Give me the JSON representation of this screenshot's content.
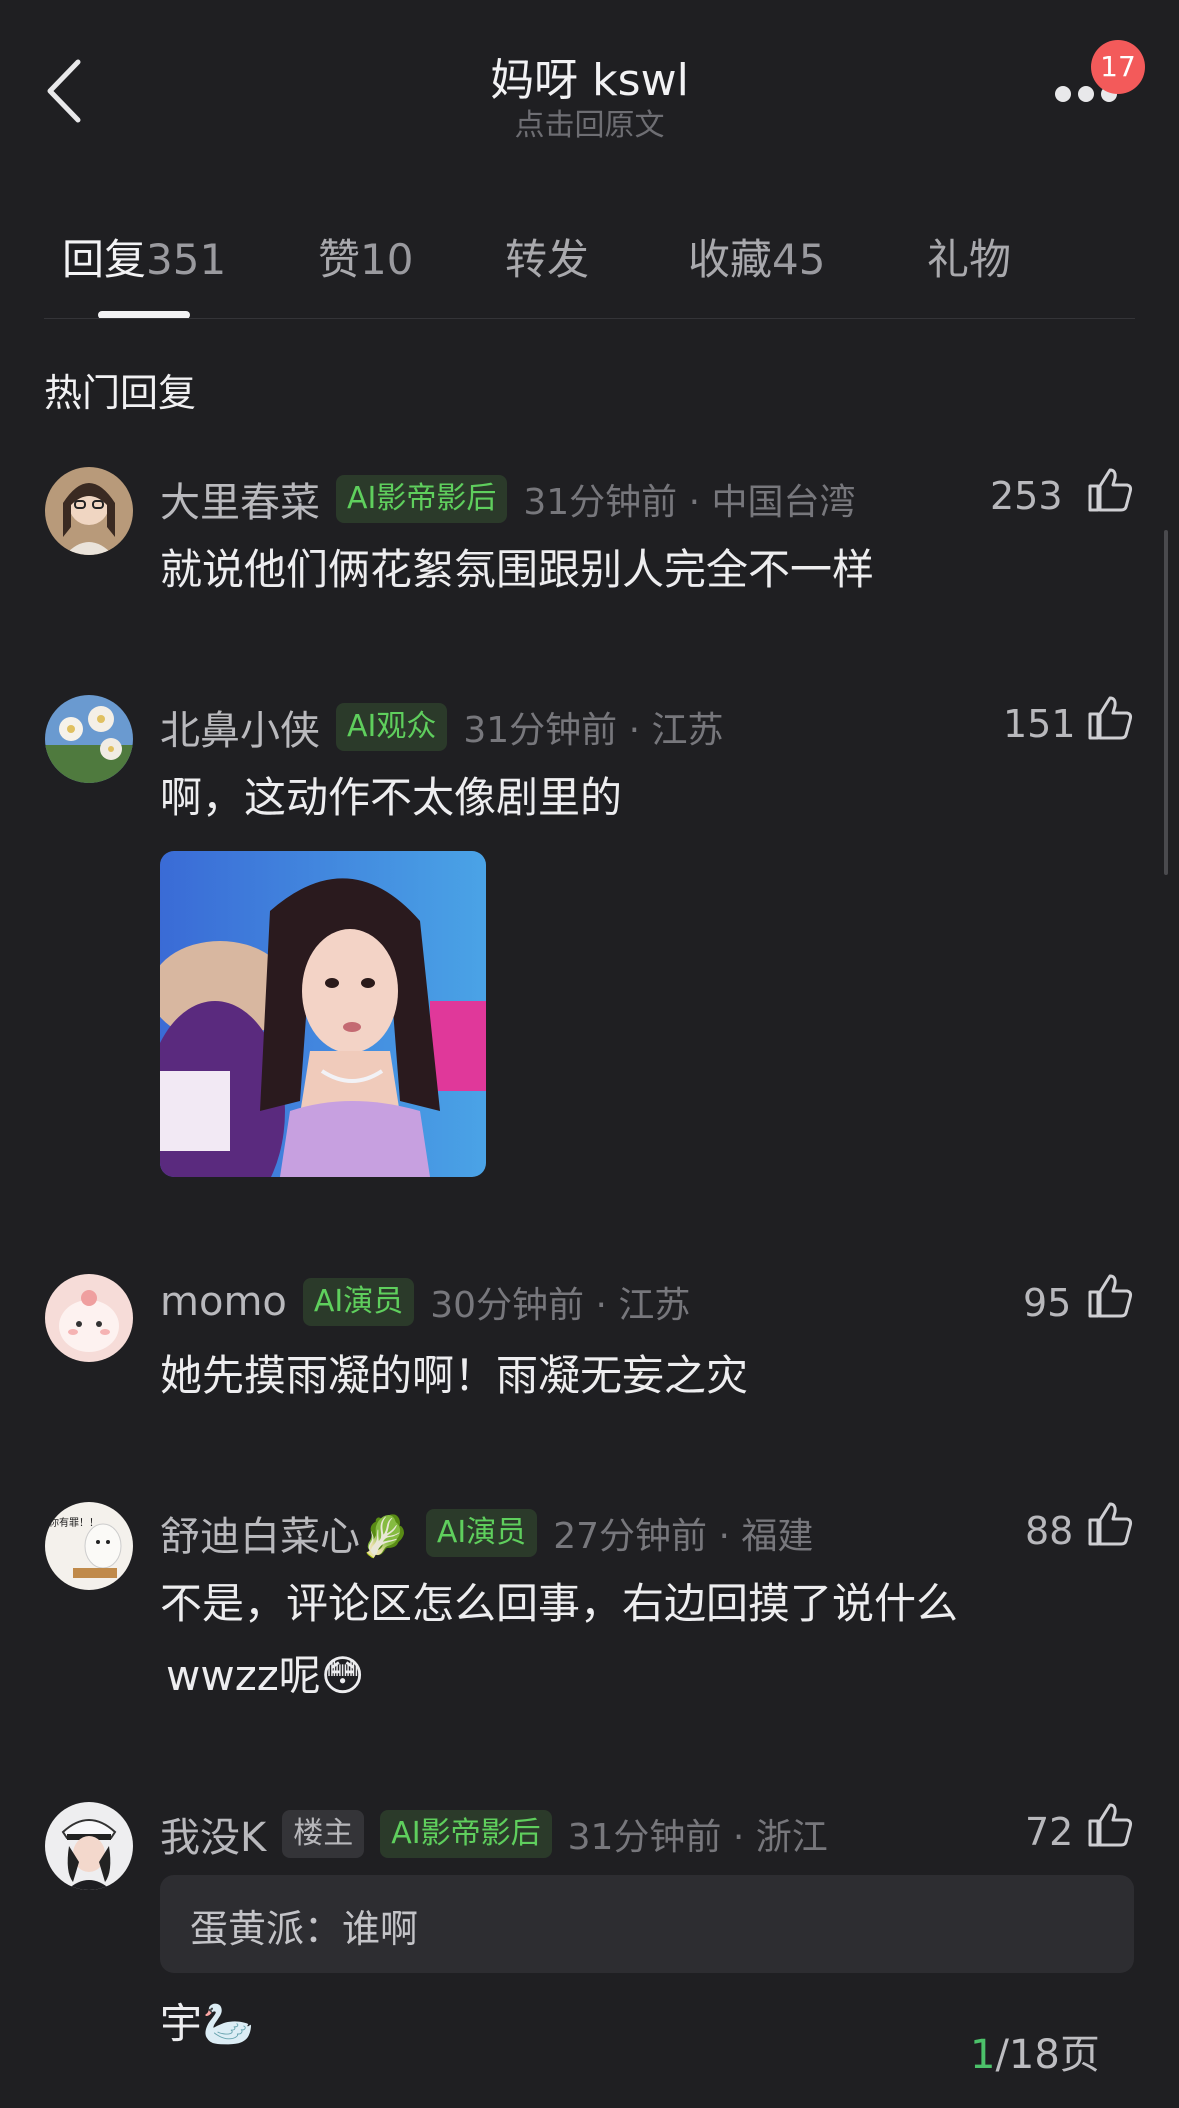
{
  "header": {
    "title": "妈呀 kswl",
    "subtitle": "点击回原文",
    "badge_count": "17"
  },
  "tabs": [
    {
      "label": "回复",
      "count": "351",
      "active": true
    },
    {
      "label": "赞",
      "count": "10"
    },
    {
      "label": "转发",
      "count": ""
    },
    {
      "label": "收藏",
      "count": "45"
    },
    {
      "label": "礼物",
      "count": ""
    }
  ],
  "section_title": "热门回复",
  "comments": [
    {
      "name": "大里春菜",
      "tag": "AI影帝影后",
      "time": "31分钟前 · 中国台湾",
      "likes": "253",
      "text": "就说他们俩花絮氛围跟别人完全不一样"
    },
    {
      "name": "北鼻小侠",
      "tag": "AI观众",
      "time": "31分钟前 · 江苏",
      "likes": "151",
      "text": "啊，这动作不太像剧里的"
    },
    {
      "name": "momo",
      "tag": "AI演员",
      "time": "30分钟前 · 江苏",
      "likes": "95",
      "text": "她先摸雨凝的啊！雨凝无妄之灾"
    },
    {
      "name": "舒迪白菜心🥬",
      "tag": "AI演员",
      "time": "27分钟前 · 福建",
      "likes": "88",
      "text_line1": "不是，评论区怎么回事，右边回摸了说什么",
      "text_line2": "wwzz呢😳",
      "avatar_text": "你有罪！！"
    },
    {
      "name": "我没K",
      "tag_lz": "楼主",
      "tag": "AI影帝影后",
      "time": "31分钟前 · 浙江",
      "likes": "72",
      "quote": "蛋黄派：谁啊",
      "text": "宇🦢"
    }
  ],
  "pager": {
    "current": "1",
    "total": "/18页"
  },
  "colors": {
    "background": "#1f1f22",
    "tag_green": "#5fcf5d",
    "badge_red": "#f35a5a"
  }
}
